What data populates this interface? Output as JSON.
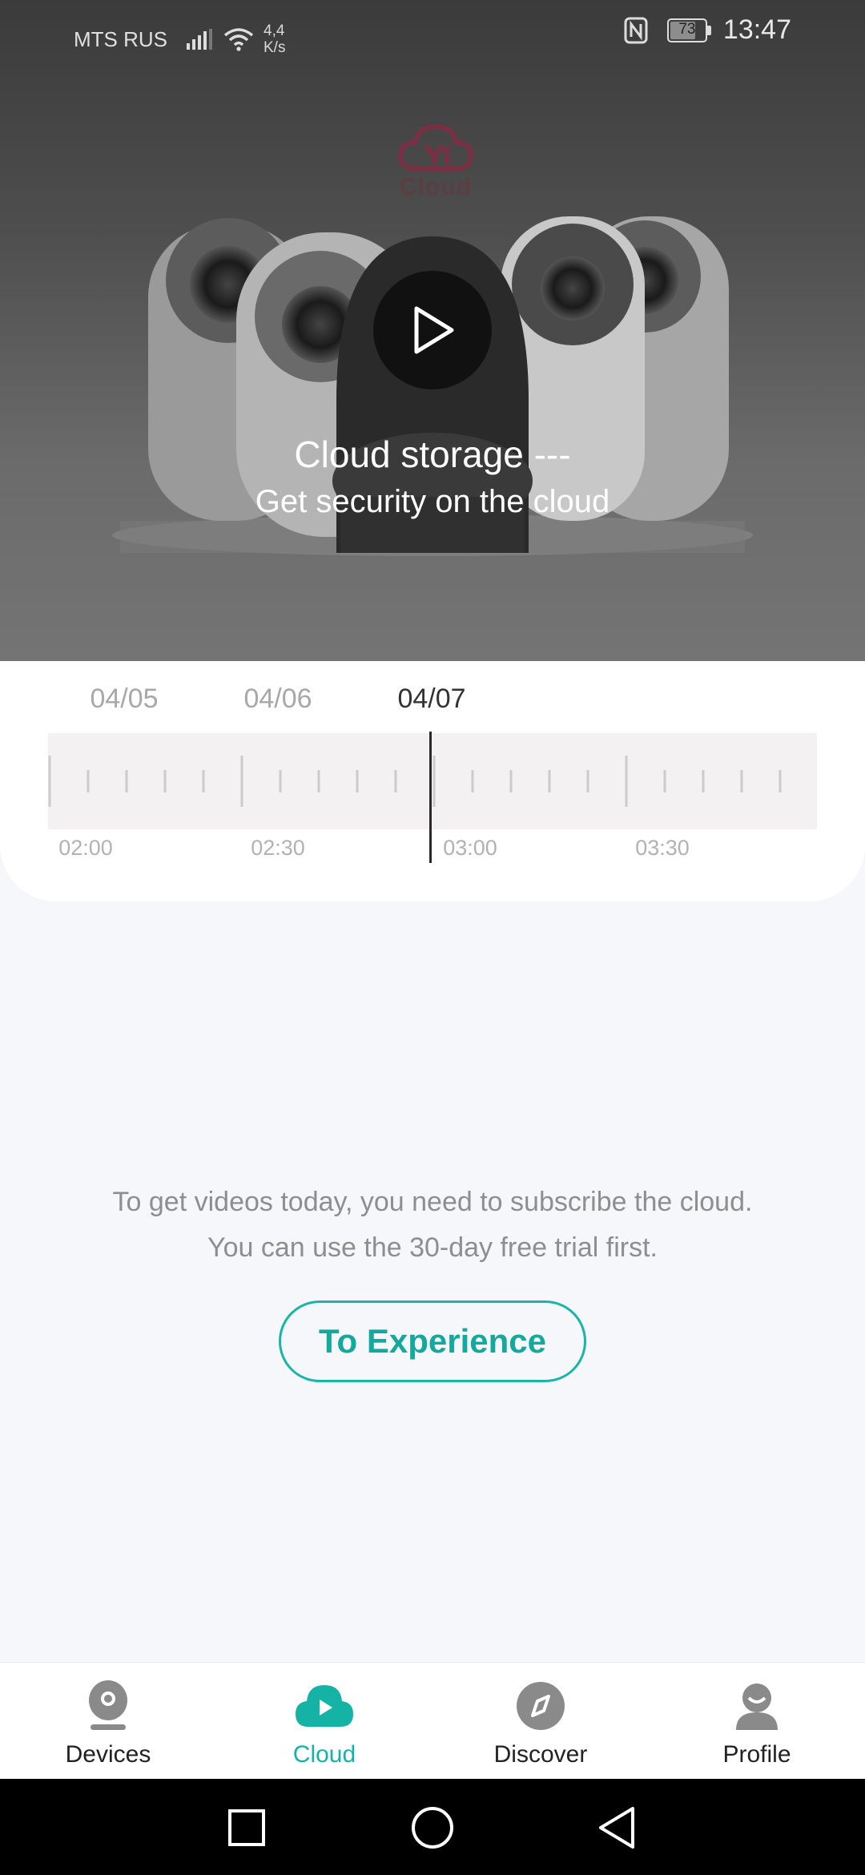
{
  "status_bar": {
    "carrier": "MTS RUS",
    "speed_value": "4,4",
    "speed_unit": "K/s",
    "battery": "73",
    "time": "13:47"
  },
  "hero": {
    "logo_text": "Cloud",
    "title": "Cloud storage ---",
    "subtitle": "Get security on the cloud"
  },
  "timeline": {
    "dates": [
      "04/05",
      "04/06",
      "04/07"
    ],
    "active_date": "04/07",
    "time_labels": [
      "02:00",
      "02:30",
      "03:00",
      "03:30"
    ]
  },
  "message": {
    "line1": "To get videos today, you need to subscribe the cloud.",
    "line2": "You can use the 30-day free trial first."
  },
  "cta_label": "To Experience",
  "bottom_nav": {
    "items": [
      {
        "label": "Devices",
        "icon": "camera-icon"
      },
      {
        "label": "Cloud",
        "icon": "cloud-play-icon"
      },
      {
        "label": "Discover",
        "icon": "compass-icon"
      },
      {
        "label": "Profile",
        "icon": "person-icon"
      }
    ],
    "active": "Cloud"
  },
  "colors": {
    "accent": "#15b3a5",
    "background": "#f6f7fb",
    "system_nav": "#000000"
  }
}
